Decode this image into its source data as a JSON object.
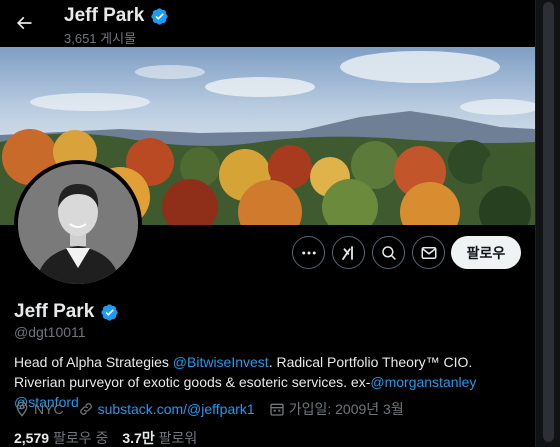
{
  "header": {
    "name": "Jeff Park",
    "post_count": "3,651 게시물"
  },
  "profile": {
    "name": "Jeff Park",
    "handle": "@dgt10011",
    "bio": {
      "p1": "Head of Alpha Strategies ",
      "link1": "@BitwiseInvest",
      "p2": ". Radical Portfolio Theory™ CIO. Riverian purveyor of exotic goods & esoteric services. ex-",
      "link2": "@morganstanley",
      "p3": " ",
      "link3": "@stanford"
    },
    "location": "NYC",
    "website": "substack.com/@jeffpark1",
    "joined": "가입일: 2009년 3월",
    "following_count": "2,579",
    "following_label": "팔로우 중",
    "followers_count": "3.7만",
    "followers_label": "팔로워"
  },
  "actions": {
    "follow_label": "팔로우",
    "more_icon": "more-icon",
    "grok_icon": "grok-icon",
    "search_icon": "search-icon",
    "message_icon": "message-icon"
  },
  "colors": {
    "accent": "#1d9bf0",
    "background": "#000000",
    "text": "#e7e9ea",
    "muted": "#71767b"
  }
}
